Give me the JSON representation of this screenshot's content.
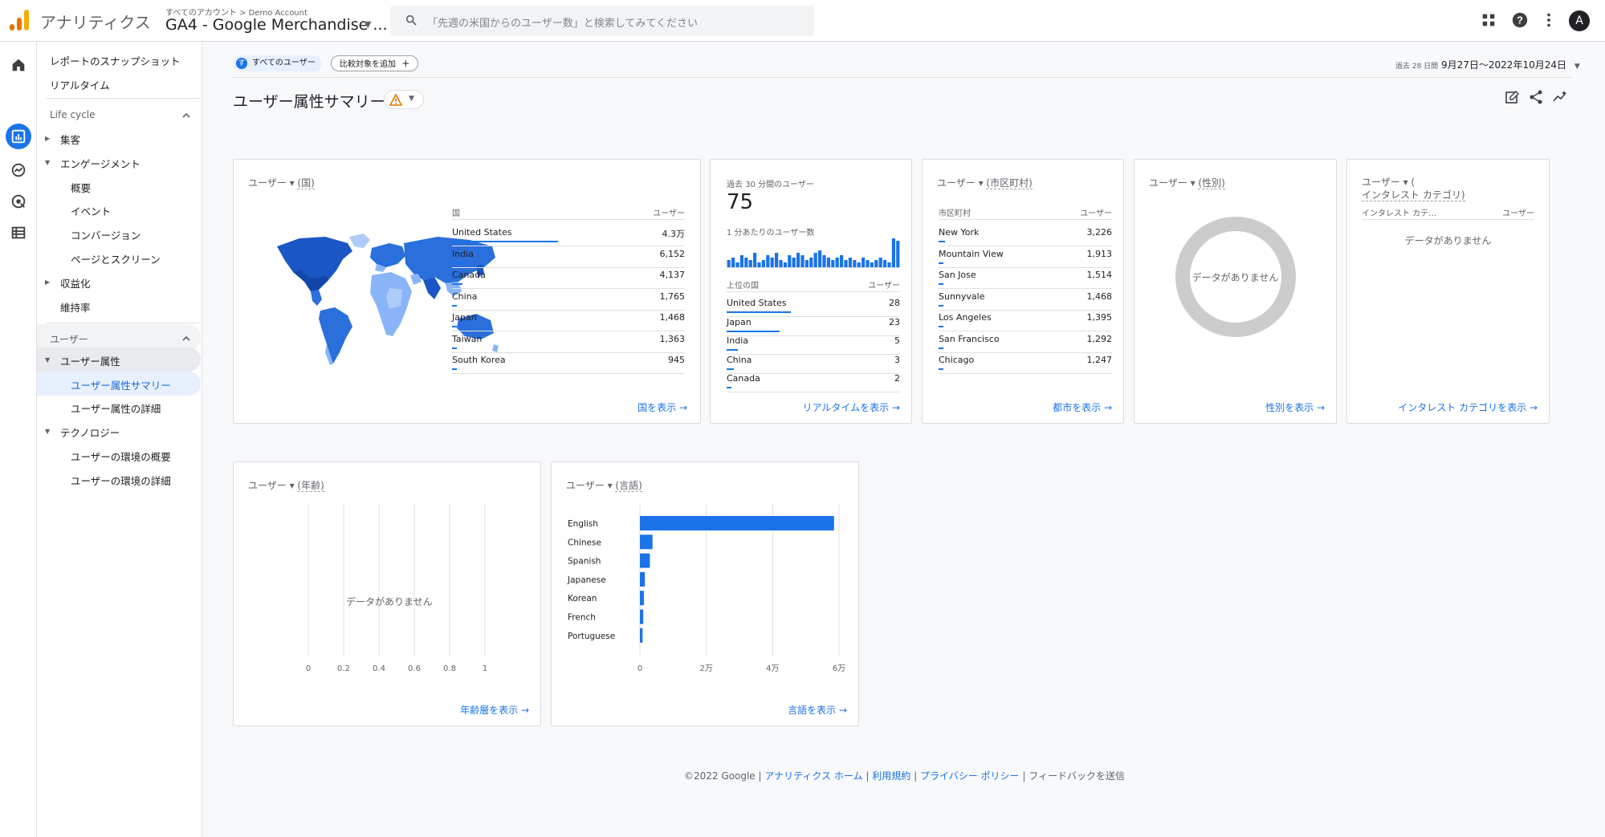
{
  "header": {
    "app_name": "アナリティクス",
    "breadcrumb": "すべてのアカウント > Demo Account",
    "property": "GA4 - Google Merchandise ...",
    "search_placeholder": "「先週の米国からのユーザー数」と検索してみてください",
    "avatar_letter": "A",
    "logo_colors": [
      "#f9ab00",
      "#e37400",
      "#e37400"
    ]
  },
  "sidebar": {
    "snapshot": "レポートのスナップショット",
    "realtime": "リアルタイム",
    "lifecycle_section": "Life cycle",
    "acquisition": "集客",
    "engagement": "エンゲージメント",
    "engagement_items": [
      "概要",
      "イベント",
      "コンバージョン",
      "ページとスクリーン"
    ],
    "monetization": "収益化",
    "retention": "維持率",
    "user_section": "ユーザー",
    "demographics": "ユーザー属性",
    "demographics_items": [
      "ユーザー属性サマリー",
      "ユーザー属性の詳細"
    ],
    "technology": "テクノロジー",
    "technology_items": [
      "ユーザーの環境の概要",
      "ユーザーの環境の詳細"
    ]
  },
  "toolbar": {
    "segment_letter": "す",
    "segment": "すべてのユーザー",
    "compare": "比較対象を追加",
    "compare_plus": "+",
    "date_label": "過去 28 日間",
    "date_range": "9月27日～2022年10月24日"
  },
  "page": {
    "title": "ユーザー属性サマリー"
  },
  "cards": {
    "country": {
      "title_prefix": "ユーザー",
      "title_dim": "(国)",
      "col1": "国",
      "col2": "ユーザー",
      "rows": [
        {
          "name": "United States",
          "value": "4.3万",
          "fraction": 1.0
        },
        {
          "name": "India",
          "value": "6,152",
          "fraction": 0.14
        },
        {
          "name": "Canada",
          "value": "4,137",
          "fraction": 0.1
        },
        {
          "name": "China",
          "value": "1,765",
          "fraction": 0.04
        },
        {
          "name": "Japan",
          "value": "1,468",
          "fraction": 0.035
        },
        {
          "name": "Taiwan",
          "value": "1,363",
          "fraction": 0.032
        },
        {
          "name": "South Korea",
          "value": "945",
          "fraction": 0.022
        }
      ],
      "link": "国を表示"
    },
    "realtime": {
      "label": "過去 30 分間のユーザー",
      "value": "75",
      "per_minute_label": "1 分あたりのユーザー数",
      "per_minute_values": [
        3,
        4,
        2,
        5,
        4,
        3,
        6,
        2,
        3,
        5,
        4,
        6,
        3,
        2,
        5,
        4,
        6,
        5,
        3,
        4,
        6,
        7,
        5,
        4,
        3,
        4,
        5,
        3,
        4,
        3,
        2,
        4,
        3,
        2,
        3,
        4,
        3,
        2,
        12,
        11
      ],
      "col1": "上位の国",
      "col2": "ユーザー",
      "rows": [
        {
          "name": "United States",
          "value": "28",
          "fraction": 1.0
        },
        {
          "name": "Japan",
          "value": "23",
          "fraction": 0.82
        },
        {
          "name": "India",
          "value": "5",
          "fraction": 0.18
        },
        {
          "name": "China",
          "value": "3",
          "fraction": 0.11
        },
        {
          "name": "Canada",
          "value": "2",
          "fraction": 0.07
        }
      ],
      "link": "リアルタイムを表示"
    },
    "city": {
      "title_prefix": "ユーザー",
      "title_dim": "(市区町村)",
      "col1": "市区町村",
      "col2": "ユーザー",
      "rows": [
        {
          "name": "New York",
          "value": "3,226",
          "fraction": 0.06
        },
        {
          "name": "Mountain View",
          "value": "1,913",
          "fraction": 0.04
        },
        {
          "name": "San Jose",
          "value": "1,514",
          "fraction": 0.035
        },
        {
          "name": "Sunnyvale",
          "value": "1,468",
          "fraction": 0.034
        },
        {
          "name": "Los Angeles",
          "value": "1,395",
          "fraction": 0.032
        },
        {
          "name": "San Francisco",
          "value": "1,292",
          "fraction": 0.03
        },
        {
          "name": "Chicago",
          "value": "1,247",
          "fraction": 0.03
        }
      ],
      "link": "都市を表示"
    },
    "gender": {
      "title_prefix": "ユーザー",
      "title_dim": "(性別)",
      "no_data": "データがありません",
      "link": "性別を表示"
    },
    "interest": {
      "title_prefix": "ユーザー",
      "title_paren": "(",
      "title_dim": "インタレスト カテゴリ)",
      "col1": "インタレスト カテ…",
      "col2": "ユーザー",
      "no_data": "データがありません",
      "link": "インタレスト カテゴリを表示"
    },
    "age": {
      "title_prefix": "ユーザー",
      "title_dim": "(年齢)",
      "no_data": "データがありません",
      "link": "年齢層を表示"
    },
    "language": {
      "title_prefix": "ユーザー",
      "title_dim": "(言語)",
      "link": "言語を表示"
    }
  },
  "chart_data": [
    {
      "type": "bar",
      "orientation": "horizontal",
      "categories": [
        "English",
        "Chinese",
        "Spanish",
        "Japanese",
        "Korean",
        "French",
        "Portuguese"
      ],
      "values": [
        58500,
        3800,
        3000,
        1500,
        1200,
        1000,
        800
      ],
      "xlim": [
        0,
        60000
      ],
      "x_ticks": [
        "0",
        "2万",
        "4万",
        "6万"
      ],
      "grid": true
    },
    {
      "type": "bar",
      "orientation": "vertical",
      "categories": [],
      "values": [],
      "ylim": [
        0,
        1
      ],
      "x_ticks": [
        "0",
        "0.2",
        "0.4",
        "0.6",
        "0.8",
        "1"
      ],
      "grid": true
    }
  ],
  "footer": {
    "copyright": "©2022 Google",
    "sep": "|",
    "links": [
      "アナリティクス ホーム",
      "利用規約",
      "プライバシー ポリシー"
    ],
    "feedback": "フィードバックを送信"
  },
  "colors": {
    "accent": "#1a73e8",
    "map_dark": "#1a56c4",
    "map_mid": "#2a6fdb",
    "map_light": "#8ab4f8",
    "donut_empty": "#cccccc"
  }
}
